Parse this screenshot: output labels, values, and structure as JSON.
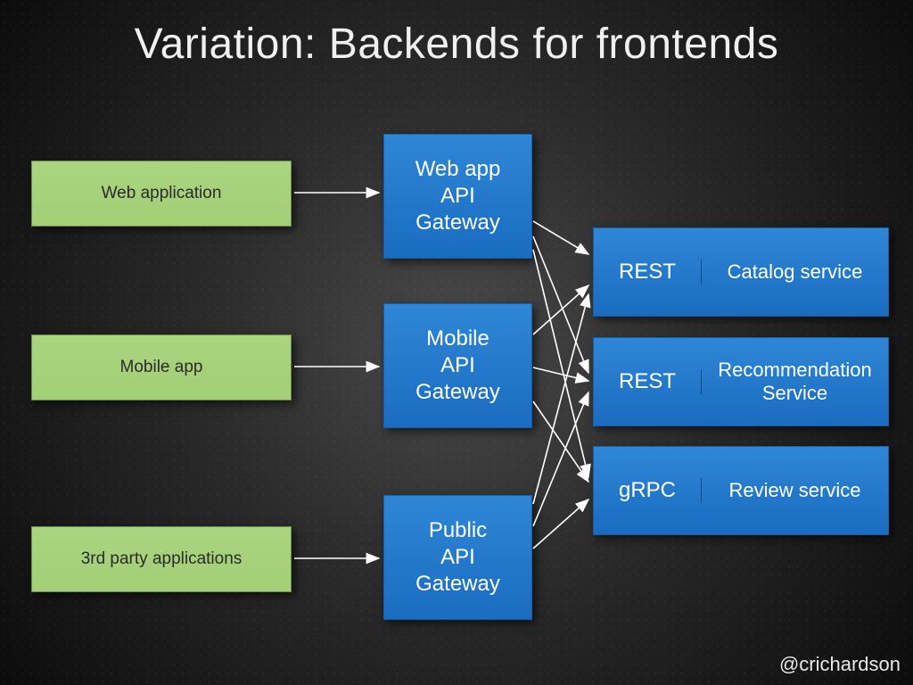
{
  "title": "Variation: Backends for frontends",
  "credit": "@crichardson",
  "clients": [
    {
      "label": "Web application"
    },
    {
      "label": "Mobile app"
    },
    {
      "label": "3rd party applications"
    }
  ],
  "gateways": [
    {
      "label": "Web app\nAPI\nGateway"
    },
    {
      "label": "Mobile\nAPI\nGateway"
    },
    {
      "label": "Public\nAPI\nGateway"
    }
  ],
  "services": [
    {
      "protocol": "REST",
      "name": "Catalog service"
    },
    {
      "protocol": "REST",
      "name": "Recommendation Service"
    },
    {
      "protocol": "gRPC",
      "name": "Review service"
    }
  ],
  "colors": {
    "client_fill": "#a7d17b",
    "gateway_fill": "#2375c7",
    "service_fill": "#2375c7",
    "arrow": "#ffffff"
  },
  "chart_data": {
    "type": "diagram",
    "edges": [
      [
        "Web application",
        "Web app API Gateway"
      ],
      [
        "Mobile app",
        "Mobile API Gateway"
      ],
      [
        "3rd party applications",
        "Public API Gateway"
      ],
      [
        "Web app API Gateway",
        "Catalog service"
      ],
      [
        "Web app API Gateway",
        "Recommendation Service"
      ],
      [
        "Web app API Gateway",
        "Review service"
      ],
      [
        "Mobile API Gateway",
        "Catalog service"
      ],
      [
        "Mobile API Gateway",
        "Recommendation Service"
      ],
      [
        "Mobile API Gateway",
        "Review service"
      ],
      [
        "Public API Gateway",
        "Catalog service"
      ],
      [
        "Public API Gateway",
        "Recommendation Service"
      ],
      [
        "Public API Gateway",
        "Review service"
      ]
    ]
  }
}
